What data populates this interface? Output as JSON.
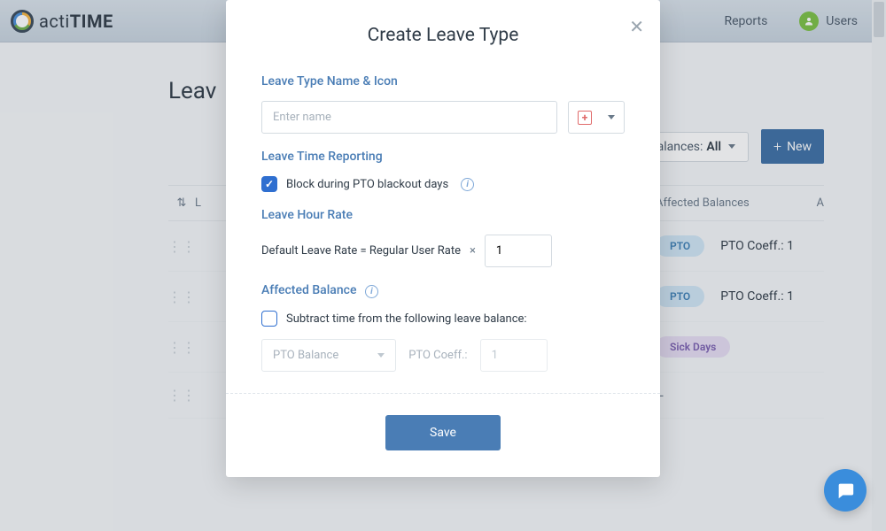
{
  "topbar": {
    "brand_prefix": "acti",
    "brand_suffix": "TIME",
    "reports": "Reports",
    "users": "Users"
  },
  "page": {
    "title": "Leav",
    "filter_label": "Affected Balances:",
    "filter_value": "All",
    "new_button": "New",
    "columns": {
      "name": "L",
      "affected": "Affected Balances",
      "actions": "A"
    },
    "rows": [
      {
        "badge": "PTO",
        "badge_class": "badge-pto",
        "coeff": "PTO Coeff.: 1"
      },
      {
        "badge": "PTO",
        "badge_class": "badge-pto",
        "coeff": "PTO Coeff.: 1"
      },
      {
        "badge": "Sick Days",
        "badge_class": "badge-sick",
        "coeff": ""
      },
      {
        "badge": "",
        "badge_class": "",
        "coeff": "--"
      }
    ]
  },
  "modal": {
    "title": "Create Leave Type",
    "sections": {
      "name": "Leave Type Name & Icon",
      "time": "Leave Time Reporting",
      "rate": "Leave Hour Rate",
      "balance": "Affected Balance"
    },
    "name_placeholder": "Enter name",
    "block_label": "Block during PTO blackout days",
    "rate_label": "Default Leave Rate = Regular User Rate",
    "rate_mult": "×",
    "rate_value": "1",
    "subtract_label": "Subtract time from the following leave balance:",
    "balance_select": "PTO Balance",
    "coeff_label": "PTO Coeff.:",
    "coeff_value": "1",
    "save": "Save"
  }
}
